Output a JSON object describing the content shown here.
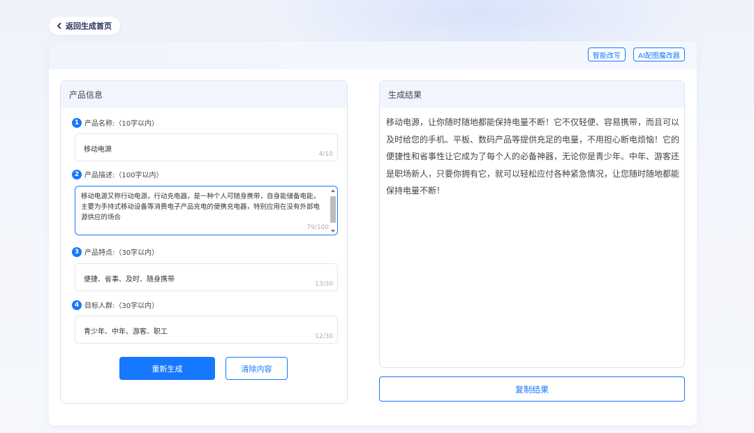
{
  "nav": {
    "back_label": "返回生成首页"
  },
  "toolbar": {
    "smart_rewrite": "智能改写",
    "ai_image_editor": "AI配图魔改器"
  },
  "product_panel": {
    "title": "产品信息",
    "fields": [
      {
        "num": "1",
        "label": "产品名称:（10字以内）",
        "value": "移动电源",
        "counter": "4/10"
      },
      {
        "num": "2",
        "label": "产品描述:（100字以内）",
        "value": "移动电源又称行动电源，行动充电器，是一种个人可随身携带，自身能储备电能，主要为手持式移动设备等消费电子产品充电的便携充电器，特别应用在没有外部电源供应的场合",
        "counter": "79/100"
      },
      {
        "num": "3",
        "label": "产品特点:（30字以内）",
        "value": "便捷、省事、及时、随身携带",
        "counter": "13/30"
      },
      {
        "num": "4",
        "label": "目标人群:（30字以内）",
        "value": "青少年、中年、游客、职工",
        "counter": "12/30"
      }
    ],
    "regenerate_label": "重新生成",
    "clear_label": "清除内容"
  },
  "result_panel": {
    "title": "生成结果",
    "text": "移动电源，让你随时随地都能保持电量不断！它不仅轻便、容易携带，而且可以及时给您的手机、平板、数码产品等提供充足的电量，不用担心断电烦恼！它的便捷性和省事性让它成为了每个人的必备神器，无论你是青少年、中年、游客还是职场新人，只要你拥有它，就可以轻松应付各种紧急情况，让您随时随地都能保持电量不断！",
    "copy_label": "复制结果"
  },
  "colors": {
    "accent": "#1677ff",
    "panel_head": "#f1f6fe",
    "border": "#d8e2f3"
  },
  "icons": {
    "back": "chevron-left-icon"
  }
}
